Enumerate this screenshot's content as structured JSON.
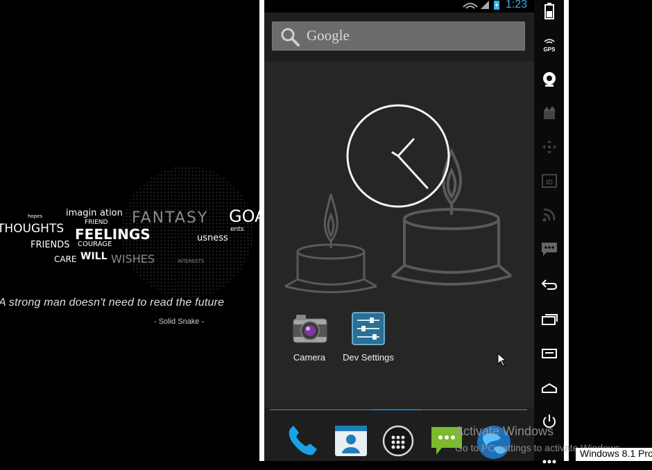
{
  "wallpaper": {
    "words": [
      "imagin",
      "ation",
      "FRIEND",
      "FANTASY",
      "GOALS",
      "THOUGHTS",
      "FEELINGS",
      "COURAGE",
      "FRIENDS",
      "CARE",
      "WILL",
      "WISHES",
      "INTERESTS",
      "usness",
      "ents",
      "hopes"
    ],
    "quote": "A strong man doesn't need to read the future",
    "quote_author": "- Solid Snake -"
  },
  "status_bar": {
    "time": "1:23"
  },
  "search": {
    "placeholder": "Google"
  },
  "apps": [
    {
      "label": "Camera",
      "icon": "camera-icon"
    },
    {
      "label": "Dev Settings",
      "icon": "dev-settings-icon"
    }
  ],
  "dock": {
    "items": [
      "phone-icon",
      "contacts-icon",
      "all-apps-icon",
      "messaging-icon",
      "browser-icon"
    ]
  },
  "sidebar": {
    "buttons": [
      "battery-icon",
      "gps-icon",
      "camera-icon",
      "media-icon",
      "dpad-icon",
      "id-icon",
      "rss-icon",
      "sms-icon",
      "back-icon",
      "recent-apps-icon",
      "menu-icon",
      "home-icon",
      "power-icon",
      "more-icon"
    ]
  },
  "overlay": {
    "activate_title": "Activate Windows",
    "activate_sub": "Go to PC settings to activate Windows.",
    "edition": "Windows 8.1 Pro"
  },
  "colors": {
    "accent": "#33b5e5",
    "dock_accent": "#1c7cb0",
    "sidebar_bg": "#0a0a0a"
  }
}
